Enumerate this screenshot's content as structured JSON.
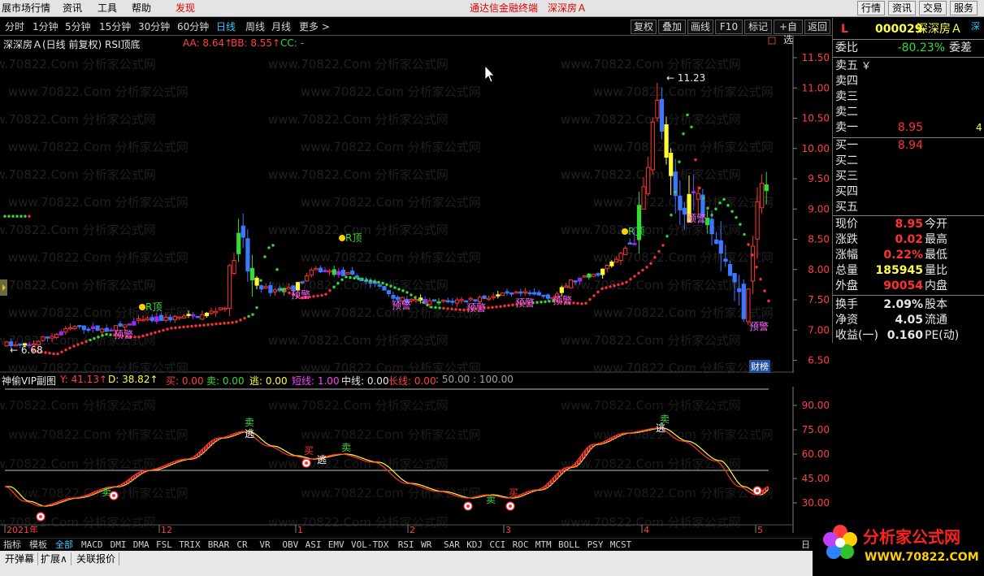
{
  "menubar": {
    "items": [
      "展市场行情",
      "资讯",
      "工具",
      "帮助"
    ],
    "discover": "发现",
    "center_title": "通达信金融终端",
    "center_stock": "深深房Ａ",
    "right_buttons": [
      "行情",
      "资讯",
      "交易",
      "服务"
    ]
  },
  "periodbar": {
    "items": [
      "分时",
      "1分钟",
      "5分钟",
      "15分钟",
      "30分钟",
      "60分钟",
      "日线",
      "周线",
      "月线",
      "更多 >"
    ],
    "active_index": 6,
    "toolbar": [
      "复权",
      "叠加",
      "画线",
      "F10",
      "标记",
      "+自选",
      "返回"
    ]
  },
  "main_legend": {
    "title": "深深房Ａ(日线 前复权) RSI顶底",
    "aa": "AA: 8.64↑",
    "bb": "BB: 8.55↑",
    "cc": "CC: -"
  },
  "main_axis": {
    "ticks": [
      "11.50",
      "11.00",
      "10.50",
      "10.00",
      "9.50",
      "9.00",
      "8.50",
      "8.00",
      "7.50",
      "7.00",
      "6.50"
    ],
    "high_label": "11.23",
    "low_label": "6.68"
  },
  "annotations": {
    "rtop": "R顶",
    "warn": "预警",
    "sell": "卖",
    "escape": "逃",
    "buy": "买",
    "finance_tag": "财榜"
  },
  "sub_legend": {
    "title": "神偷VIP副图",
    "y": "Y: 41.13↑",
    "d": "D: 38.82↑",
    "buy": "买: 0.00",
    "sell": "卖: 0.00",
    "escape": "逃: 0.00",
    "short": "短线: 1.00",
    "mid": "中线: 0.00",
    "long": "长线: 0.00",
    "scale": ": 50.00 : 100.00"
  },
  "sub_axis": {
    "ticks": [
      "90.00",
      "75.00",
      "60.00",
      "45.00",
      "30.00"
    ]
  },
  "date_axis": [
    "2021年",
    "12",
    "1",
    "2",
    "3",
    "4",
    "5"
  ],
  "tabs": [
    "指标",
    "模板",
    "全部",
    "MACD",
    "DMI",
    "DMA",
    "FSL",
    "TRIX",
    "BRAR",
    "CR",
    "VR",
    "OBV",
    "ASI",
    "EMV",
    "VOL-TDX",
    "RSI",
    "WR",
    "SAR",
    "KDJ",
    "CCI",
    "ROC",
    "MTM",
    "BOLL",
    "PSY",
    "MCST"
  ],
  "tabs_active_index": 2,
  "bottom_buttons": [
    "开弹幕",
    "扩展∧",
    "关联报价"
  ],
  "tabbar_right": "日",
  "quote": {
    "market_flag": "L",
    "code": "000029",
    "name": "深深房Ａ",
    "side_tag": "深",
    "weibi_label": "委比",
    "weibi": "-80.23%",
    "weicha_label": "委差",
    "asks": [
      {
        "label": "卖五",
        "price": "",
        "vol": "￥"
      },
      {
        "label": "卖四",
        "price": "",
        "vol": ""
      },
      {
        "label": "卖三",
        "price": "",
        "vol": ""
      },
      {
        "label": "卖二",
        "price": "",
        "vol": ""
      },
      {
        "label": "卖一",
        "price": "8.95",
        "vol": "4"
      }
    ],
    "bids": [
      {
        "label": "买一",
        "price": "8.94",
        "vol": ""
      },
      {
        "label": "买二",
        "price": "",
        "vol": ""
      },
      {
        "label": "买三",
        "price": "",
        "vol": ""
      },
      {
        "label": "买四",
        "price": "",
        "vol": ""
      },
      {
        "label": "买五",
        "price": "",
        "vol": ""
      }
    ],
    "stats": [
      {
        "label": "现价",
        "value": "8.95",
        "color": "#ff3232",
        "label2": "今开"
      },
      {
        "label": "涨跌",
        "value": "0.02",
        "color": "#ff3232",
        "label2": "最高"
      },
      {
        "label": "涨幅",
        "value": "0.22%",
        "color": "#ff3232",
        "label2": "最低"
      },
      {
        "label": "总量",
        "value": "185945",
        "color": "#ffff40",
        "label2": "量比"
      },
      {
        "label": "外盘",
        "value": "90054",
        "color": "#ff3232",
        "label2": "内盘"
      },
      {
        "label": "换手",
        "value": "2.09%",
        "color": "#e8e8e8",
        "label2": "股本"
      },
      {
        "label": "净资",
        "value": "4.05",
        "color": "#e8e8e8",
        "label2": "流通"
      },
      {
        "label": "收益(一)",
        "value": "0.160",
        "color": "#e8e8e8",
        "label2": "PE(动)"
      }
    ]
  },
  "logo": {
    "name": "分析家公式网",
    "url": "WWW.70822.COM"
  },
  "colors": {
    "up": "#ff3232",
    "down": "#3c78ff",
    "green": "#32dc32",
    "yellow": "#ffff32",
    "purple": "#a028ff",
    "cyan": "#35c8ff"
  }
}
